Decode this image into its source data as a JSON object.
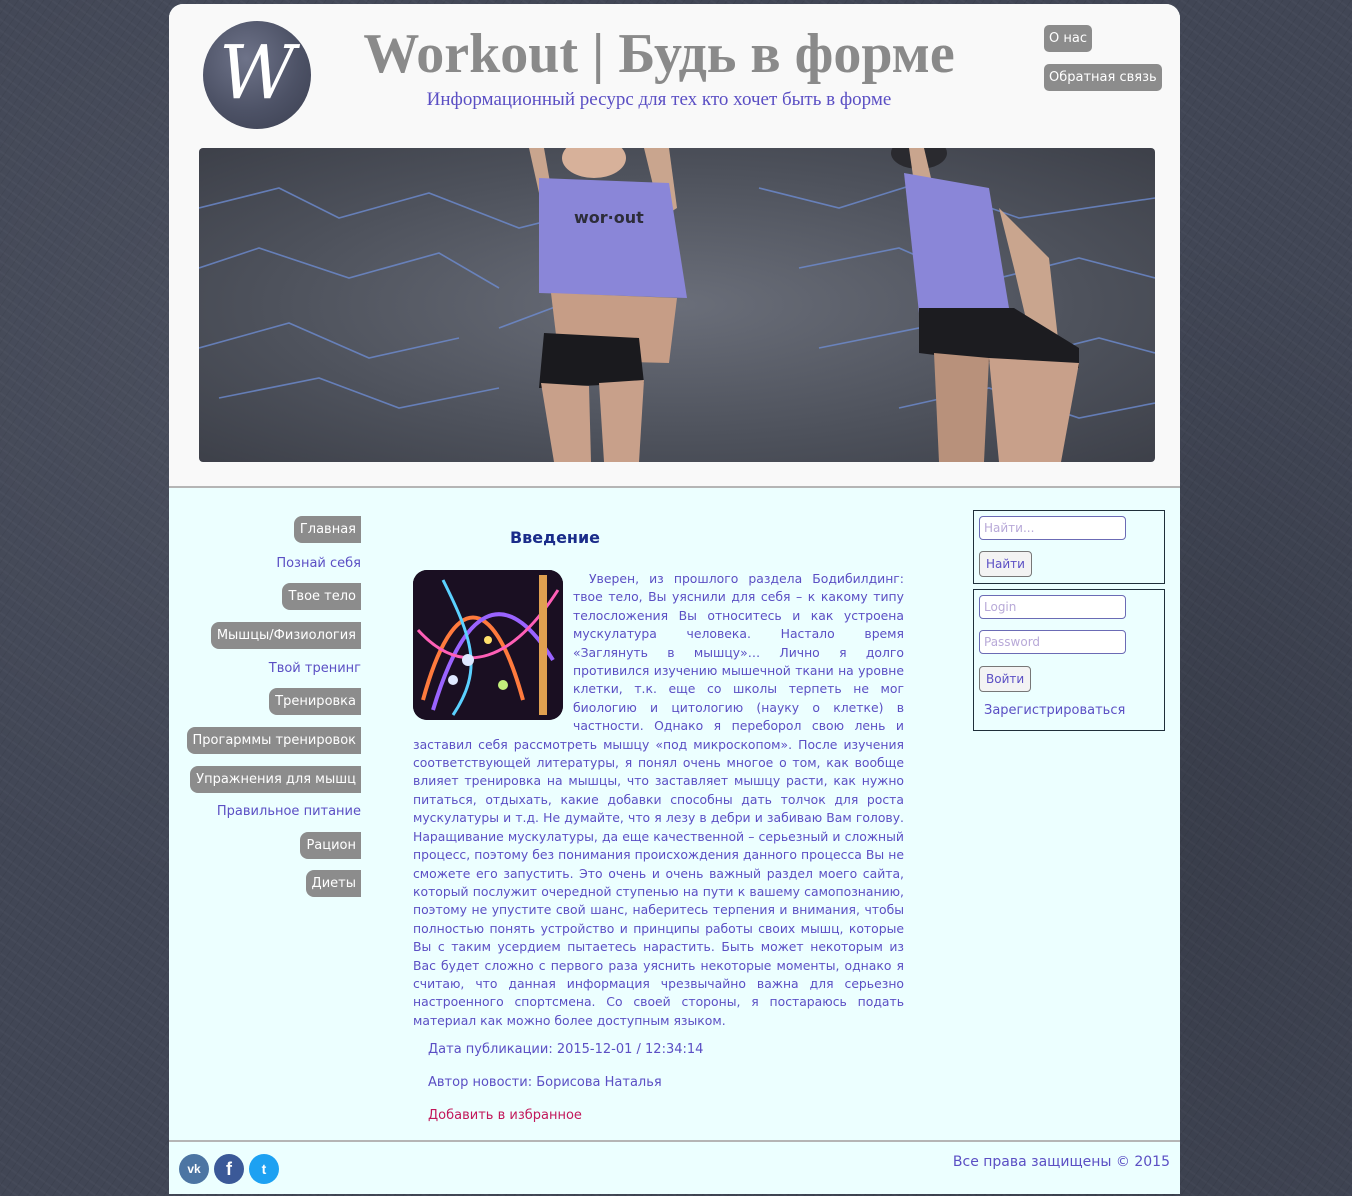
{
  "header": {
    "logo_letter": "W",
    "title": "Workout | Будь в форме",
    "subtitle": "Информационный ресурс для тех кто хочет быть в форме",
    "top_links": [
      "О нас",
      "Обратная связь"
    ]
  },
  "banner": {
    "shirt_text": "wor·out"
  },
  "leftnav": [
    {
      "label": "Главная",
      "style": "button"
    },
    {
      "label": "Познай себя",
      "style": "link"
    },
    {
      "label": "Твое тело",
      "style": "button"
    },
    {
      "label": "Мышцы/Физиология",
      "style": "button"
    },
    {
      "label": "Твой тренинг",
      "style": "link"
    },
    {
      "label": "Тренировка",
      "style": "button"
    },
    {
      "label": "Прогарммы тренировок",
      "style": "button"
    },
    {
      "label": "Упражнения для мышц",
      "style": "button"
    },
    {
      "label": "Правильное питание",
      "style": "link"
    },
    {
      "label": "Рацион",
      "style": "button"
    },
    {
      "label": "Диеты",
      "style": "button"
    }
  ],
  "article": {
    "title": "Введение",
    "body": "Уверен, из прошлого раздела Бодибилдинг: твое тело, Вы уяснили для себя – к какому типу телосложения Вы относитесь и как устроена мускулатура человека. Настало время «Заглянуть в мышцу»… Лично я долго противился изучению мышечной ткани на уровне клетки, т.к. еще со школы терпеть не мог биологию и цитологию (науку о клетке) в частности. Однако я переборол свою лень и заставил себя рассмотреть мышцу «под микроскопом». После изучения соответствующей литературы, я понял очень многое о том, как вообще влияет тренировка на мышцы, что заставляет мышцу расти, как нужно питаться, отдыхать, какие добавки способны дать толчок для роста мускулатуры и т.д. Не думайте, что я лезу в дебри и забиваю Вам голову. Наращивание мускулатуры, да еще качественной – серьезный и сложный процесс, поэтому без понимания происхождения данного процесса Вы не сможете его запустить. Это очень и очень важный раздел моего сайта, который послужит очередной ступенью на пути к вашему самопознанию, поэтому не упустите свой шанс, наберитесь терпения и внимания, чтобы полностью понять устройство и принципы работы своих мышц, которые Вы с таким усердием пытаетесь нарастить. Быть может некоторым из Вас будет сложно с первого раза уяснить некоторые моменты, однако я считаю, что данная информация чрезвычайно важна для серьезно настроенного спортсмена. Со своей стороны, я постараюсь подать материал как можно более доступным языком.",
    "published": "Дата публикации: 2015-12-01 / 12:34:14",
    "author": "Автор новости: Борисова Наталья",
    "favorite": "Добавить в избранное"
  },
  "search": {
    "placeholder": "Найти...",
    "button": "Найти"
  },
  "login": {
    "login_placeholder": "Login",
    "password_placeholder": "Password",
    "button": "Войти",
    "register": "Зарегистрироваться"
  },
  "footer": {
    "social": [
      {
        "name": "vk-icon",
        "glyph": "vk",
        "color": "#4c75a3"
      },
      {
        "name": "facebook-icon",
        "glyph": "f",
        "color": "#3b5998"
      },
      {
        "name": "twitter-icon",
        "glyph": "t",
        "color": "#1da1f2"
      }
    ],
    "copyright": "Все права защищены © 2015"
  },
  "colors": {
    "accent_text": "#5b4fc4",
    "button_gray": "#8c8c8c",
    "content_bg": "#ecffff",
    "favorite_link": "#c2185b"
  }
}
